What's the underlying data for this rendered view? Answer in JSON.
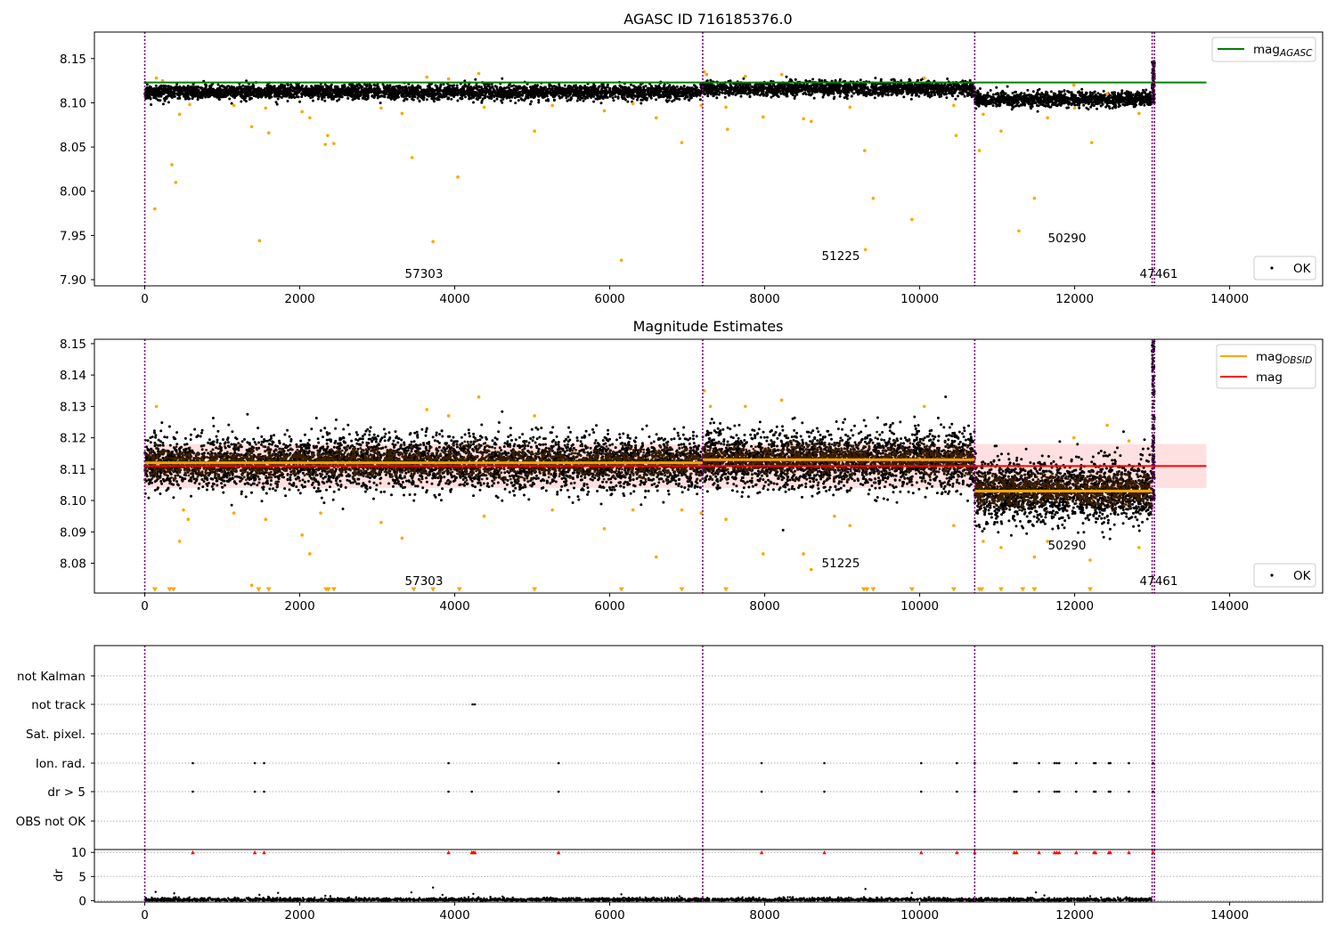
{
  "chart_data": [
    {
      "type": "scatter",
      "title": "AGASC ID 716185376.0",
      "xlabel": "",
      "ylabel": "",
      "xlim": [
        -650,
        15200
      ],
      "ylim": [
        7.893,
        8.18
      ],
      "x_ticks": [
        0,
        2000,
        4000,
        6000,
        8000,
        10000,
        12000,
        14000
      ],
      "y_ticks": [
        7.9,
        7.95,
        8.0,
        8.05,
        8.1,
        8.15
      ],
      "grid": false,
      "legend": {
        "placement": "top-right (mag_AGASC), bottom-right (OK)",
        "entries": [
          {
            "label": "mag",
            "sub": "AGASC",
            "kind": "line",
            "color": "#008000"
          },
          {
            "label": "OK",
            "kind": "marker",
            "color": "#000000"
          }
        ]
      },
      "hlines": [
        {
          "name": "mag_AGASC",
          "y": 8.123,
          "x": [
            0,
            13700
          ],
          "color": "#008000"
        }
      ],
      "boundaries": [
        0,
        7200,
        10710,
        13000,
        13030
      ],
      "boundary_color": "#800080",
      "segments": [
        {
          "x": [
            0,
            7200
          ],
          "center": 8.112,
          "spread": 0.0045,
          "count": 3600
        },
        {
          "x": [
            7200,
            10710
          ],
          "center": 8.116,
          "spread": 0.0045,
          "count": 1800
        },
        {
          "x": [
            10710,
            13000
          ],
          "center": 8.104,
          "spread": 0.0045,
          "count": 1200
        }
      ],
      "rise": {
        "x": [
          13000,
          13030
        ],
        "y_range": [
          8.1,
          8.15
        ],
        "count": 70
      },
      "annotations": [
        {
          "text": "57303",
          "x": 3600,
          "y": 7.907
        },
        {
          "text": "51225",
          "x": 8950,
          "y": 7.927
        },
        {
          "text": "50290",
          "x": 11850,
          "y": 7.947
        },
        {
          "text": "47461",
          "x": 13000,
          "y": 7.907
        }
      ],
      "outliers_orange": [
        [
          130,
          7.98
        ],
        [
          150,
          8.128
        ],
        [
          230,
          8.125
        ],
        [
          350,
          8.03
        ],
        [
          400,
          8.01
        ],
        [
          450,
          8.087
        ],
        [
          580,
          8.098
        ],
        [
          1150,
          8.097
        ],
        [
          1380,
          8.073
        ],
        [
          1480,
          7.944
        ],
        [
          1560,
          8.094
        ],
        [
          1600,
          8.066
        ],
        [
          2030,
          8.09
        ],
        [
          2130,
          8.083
        ],
        [
          2330,
          8.053
        ],
        [
          2360,
          8.063
        ],
        [
          2440,
          8.054
        ],
        [
          3050,
          8.094
        ],
        [
          3320,
          8.088
        ],
        [
          3450,
          8.038
        ],
        [
          3640,
          8.129
        ],
        [
          3720,
          7.943
        ],
        [
          3920,
          8.127
        ],
        [
          4040,
          8.016
        ],
        [
          4310,
          8.133
        ],
        [
          4380,
          8.095
        ],
        [
          5030,
          8.068
        ],
        [
          5260,
          8.097
        ],
        [
          5930,
          8.091
        ],
        [
          6150,
          7.922
        ],
        [
          6300,
          8.099
        ],
        [
          6600,
          8.083
        ],
        [
          6930,
          8.055
        ],
        [
          7180,
          8.097
        ],
        [
          7220,
          8.135
        ],
        [
          7250,
          8.132
        ],
        [
          7500,
          8.095
        ],
        [
          7520,
          8.07
        ],
        [
          7750,
          8.13
        ],
        [
          7980,
          8.084
        ],
        [
          8220,
          8.132
        ],
        [
          8500,
          8.082
        ],
        [
          8600,
          8.079
        ],
        [
          9100,
          8.095
        ],
        [
          9300,
          7.934
        ],
        [
          9290,
          8.046
        ],
        [
          9400,
          7.992
        ],
        [
          9900,
          7.968
        ],
        [
          10060,
          8.128
        ],
        [
          10440,
          8.097
        ],
        [
          10470,
          8.063
        ],
        [
          10770,
          8.046
        ],
        [
          10820,
          8.087
        ],
        [
          11050,
          8.068
        ],
        [
          11280,
          7.955
        ],
        [
          11480,
          7.992
        ],
        [
          11650,
          8.083
        ],
        [
          11990,
          8.12
        ],
        [
          12000,
          8.094
        ],
        [
          12220,
          8.055
        ],
        [
          12420,
          8.11
        ],
        [
          12830,
          8.088
        ]
      ]
    },
    {
      "type": "scatter",
      "title": "Magnitude Estimates",
      "xlabel": "",
      "ylabel": "",
      "xlim": [
        -650,
        15200
      ],
      "ylim": [
        8.0705,
        8.1514
      ],
      "x_ticks": [
        0,
        2000,
        4000,
        6000,
        8000,
        10000,
        12000,
        14000
      ],
      "y_ticks": [
        8.08,
        8.09,
        8.1,
        8.11,
        8.12,
        8.13,
        8.14,
        8.15
      ],
      "grid": false,
      "legend": {
        "placement": "top-right (mag_OBSID, mag), bottom-right (OK)",
        "entries": [
          {
            "label": "mag",
            "sub": "OBSID",
            "kind": "line",
            "color": "#ffa500"
          },
          {
            "label": "mag",
            "kind": "line",
            "color": "#ff0000"
          },
          {
            "label": "OK",
            "kind": "marker",
            "color": "#000000"
          }
        ]
      },
      "mag_line": {
        "y": 8.111,
        "band": [
          8.104,
          8.118
        ],
        "x": [
          0,
          13700
        ],
        "color": "#ff0000"
      },
      "obsid_levels": [
        {
          "x": [
            0,
            7200
          ],
          "y": 8.112
        },
        {
          "x": [
            7200,
            10710
          ],
          "y": 8.113
        },
        {
          "x": [
            10710,
            13000
          ],
          "y": 8.103
        }
      ],
      "boundaries": [
        0,
        7200,
        10710,
        13000,
        13030
      ],
      "boundary_color": "#800080",
      "segments": [
        {
          "x": [
            0,
            7200
          ],
          "center": 8.112,
          "spread": 0.0048,
          "count": 4200
        },
        {
          "x": [
            7200,
            10710
          ],
          "center": 8.113,
          "spread": 0.0052,
          "count": 2200
        },
        {
          "x": [
            10710,
            13000
          ],
          "center": 8.103,
          "spread": 0.0055,
          "count": 1600
        }
      ],
      "rise": {
        "x": [
          13000,
          13030
        ],
        "y_range": [
          8.1,
          8.151
        ],
        "count": 90
      },
      "annotations": [
        {
          "text": "57303",
          "x": 3600,
          "y": 8.0735
        },
        {
          "text": "51225",
          "x": 8950,
          "y": 8.0785
        },
        {
          "text": "50290",
          "x": 11850,
          "y": 8.0835
        },
        {
          "text": "47461",
          "x": 13000,
          "y": 8.0735
        }
      ],
      "outliers_orange": [
        [
          150,
          8.13
        ],
        [
          500,
          8.097
        ],
        [
          560,
          8.094
        ],
        [
          450,
          8.087
        ],
        [
          1150,
          8.096
        ],
        [
          1380,
          8.073
        ],
        [
          1560,
          8.094
        ],
        [
          2030,
          8.089
        ],
        [
          2130,
          8.083
        ],
        [
          2270,
          8.096
        ],
        [
          3050,
          8.093
        ],
        [
          3320,
          8.088
        ],
        [
          3640,
          8.129
        ],
        [
          3920,
          8.127
        ],
        [
          4310,
          8.133
        ],
        [
          4380,
          8.095
        ],
        [
          5030,
          8.127
        ],
        [
          5260,
          8.097
        ],
        [
          5930,
          8.091
        ],
        [
          6300,
          8.097
        ],
        [
          6600,
          8.082
        ],
        [
          6930,
          8.097
        ],
        [
          7180,
          8.096
        ],
        [
          7220,
          8.135
        ],
        [
          7300,
          8.13
        ],
        [
          7500,
          8.094
        ],
        [
          7750,
          8.13
        ],
        [
          7980,
          8.083
        ],
        [
          8220,
          8.132
        ],
        [
          8500,
          8.083
        ],
        [
          8600,
          8.078
        ],
        [
          8900,
          8.095
        ],
        [
          9100,
          8.092
        ],
        [
          10060,
          8.13
        ],
        [
          10440,
          8.092
        ],
        [
          10820,
          8.087
        ],
        [
          11050,
          8.085
        ],
        [
          11480,
          8.082
        ],
        [
          11650,
          8.087
        ],
        [
          11990,
          8.12
        ],
        [
          12200,
          8.081
        ],
        [
          12420,
          8.124
        ],
        [
          12830,
          8.085
        ],
        [
          12700,
          8.119
        ]
      ],
      "clipped_low_markers": [
        130,
        320,
        370,
        1470,
        1600,
        2340,
        2370,
        2440,
        3470,
        3720,
        4060,
        5030,
        6150,
        6930,
        7500,
        9280,
        9320,
        9400,
        9900,
        10440,
        10770,
        10800,
        11050,
        11330,
        11480,
        12200
      ]
    },
    {
      "type": "scatter",
      "title": "",
      "xlabel": "",
      "ylabel": "",
      "xlim": [
        -650,
        15200
      ],
      "categories": [
        "not Kalman",
        "not track",
        "Sat. pixel.",
        "Ion. rad.",
        "dr > 5",
        "OBS not OK"
      ],
      "boundaries": [
        0,
        7200,
        10710,
        13000,
        13030
      ],
      "flags": {
        "not Kalman": [],
        "not track": [
          4230,
          4260
        ],
        "Sat. pixel.": [],
        "Ion. rad.": [
          620,
          1420,
          1540,
          3920,
          5340,
          7960,
          8770,
          10020,
          10480,
          10710,
          11220,
          11250,
          11540,
          11740,
          11770,
          11800,
          12020,
          12250,
          12270,
          12440,
          12460,
          12700,
          13010
        ],
        "dr > 5": [
          620,
          1420,
          1540,
          3920,
          4220,
          5340,
          7960,
          8770,
          10020,
          10480,
          10710,
          11220,
          11250,
          11540,
          11740,
          11770,
          11800,
          12020,
          12250,
          12270,
          12440,
          12460,
          12700,
          13010
        ],
        "OBS not OK": []
      }
    },
    {
      "type": "scatter",
      "title": "",
      "xlabel": "",
      "ylabel": "dr",
      "xlim": [
        -650,
        15200
      ],
      "ylim": [
        -0.3,
        10.6
      ],
      "y_ticks": [
        0,
        5,
        10
      ],
      "x_ticks": [
        0,
        2000,
        4000,
        6000,
        8000,
        10000,
        12000,
        14000
      ],
      "clip_value": 10,
      "clipped_markers_x": [
        620,
        1420,
        1540,
        3920,
        4220,
        4240,
        4260,
        5340,
        7960,
        8770,
        10020,
        10480,
        10710,
        11220,
        11250,
        11540,
        11740,
        11770,
        11800,
        12020,
        12250,
        12270,
        12440,
        12460,
        12700,
        13010
      ],
      "scattered_points": [
        [
          140,
          1.8
        ],
        [
          380,
          1.5
        ],
        [
          1480,
          1.2
        ],
        [
          1720,
          1.6
        ],
        [
          2330,
          1.0
        ],
        [
          3440,
          1.7
        ],
        [
          3720,
          2.7
        ],
        [
          4240,
          1.4
        ],
        [
          6150,
          1.3
        ],
        [
          6900,
          0.9
        ],
        [
          9300,
          2.4
        ],
        [
          9900,
          1.6
        ],
        [
          11500,
          1.7
        ],
        [
          12200,
          0.9
        ]
      ],
      "base_band": {
        "y_range": [
          0,
          0.6
        ],
        "count": 3200
      }
    }
  ]
}
